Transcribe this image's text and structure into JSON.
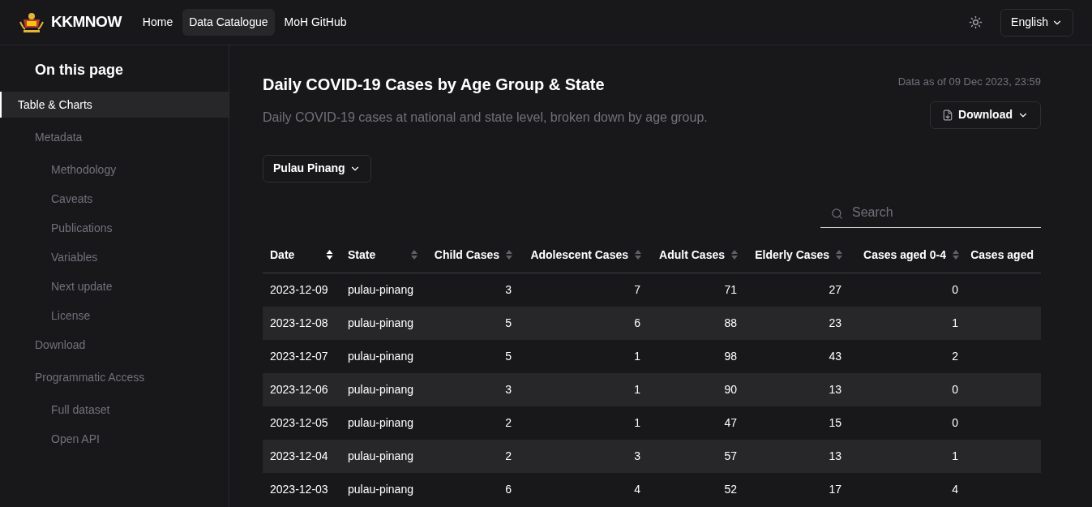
{
  "header": {
    "brand": "KKMNOW",
    "nav": [
      {
        "label": "Home",
        "selected": false
      },
      {
        "label": "Data Catalogue",
        "selected": true
      },
      {
        "label": "MoH GitHub",
        "selected": false
      }
    ],
    "language": "English"
  },
  "sidebar": {
    "title": "On this page",
    "items": [
      {
        "label": "Table & Charts",
        "selected": true
      },
      {
        "label": "Metadata",
        "selected": false,
        "children": [
          {
            "label": "Methodology",
            "selected": false
          },
          {
            "label": "Caveats",
            "selected": false
          },
          {
            "label": "Publications",
            "selected": false
          },
          {
            "label": "Variables",
            "selected": false
          },
          {
            "label": "Next update",
            "selected": false
          },
          {
            "label": "License",
            "selected": false
          }
        ]
      },
      {
        "label": "Download",
        "selected": false
      },
      {
        "label": "Programmatic Access",
        "selected": false,
        "children": [
          {
            "label": "Full dataset",
            "selected": false
          },
          {
            "label": "Open API",
            "selected": false
          }
        ]
      }
    ]
  },
  "main": {
    "title": "Daily COVID-19 Cases by Age Group & State",
    "description": "Daily COVID-19 cases at national and state level, broken down by age group.",
    "data_as_of": "Data as of 09 Dec 2023, 23:59",
    "download_button": "Download",
    "state_filter": "Pulau Pinang",
    "search": {
      "placeholder": "Search"
    }
  },
  "table": {
    "columns": [
      {
        "label": "Date",
        "sorted": true
      },
      {
        "label": "State",
        "sorted": false
      },
      {
        "label": "Child Cases",
        "sorted": false
      },
      {
        "label": "Adolescent Cases",
        "sorted": false
      },
      {
        "label": "Adult Cases",
        "sorted": false
      },
      {
        "label": "Elderly Cases",
        "sorted": false
      },
      {
        "label": "Cases aged 0-4",
        "sorted": false
      },
      {
        "label": "Cases aged"
      }
    ],
    "rows": [
      [
        "2023-12-09",
        "pulau-pinang",
        "3",
        "7",
        "71",
        "27",
        "0"
      ],
      [
        "2023-12-08",
        "pulau-pinang",
        "5",
        "6",
        "88",
        "23",
        "1"
      ],
      [
        "2023-12-07",
        "pulau-pinang",
        "5",
        "1",
        "98",
        "43",
        "2"
      ],
      [
        "2023-12-06",
        "pulau-pinang",
        "3",
        "1",
        "90",
        "13",
        "0"
      ],
      [
        "2023-12-05",
        "pulau-pinang",
        "2",
        "1",
        "47",
        "15",
        "0"
      ],
      [
        "2023-12-04",
        "pulau-pinang",
        "2",
        "3",
        "57",
        "13",
        "1"
      ],
      [
        "2023-12-03",
        "pulau-pinang",
        "6",
        "4",
        "52",
        "17",
        "4"
      ]
    ]
  }
}
